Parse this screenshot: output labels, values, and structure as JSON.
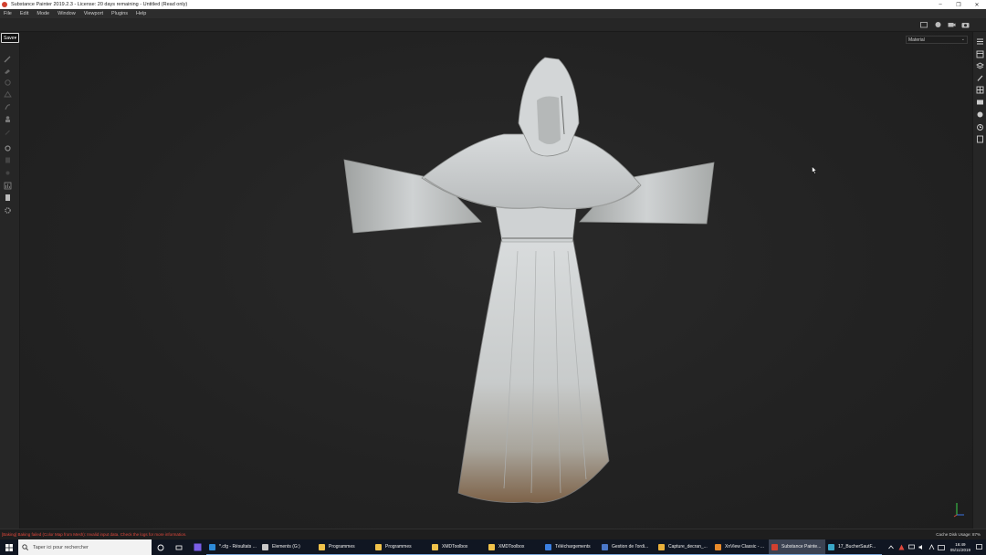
{
  "window": {
    "title": "Substance Painter 2019.2.3 - License: 20 days remaining - Untitled (Read only)",
    "controls": [
      "–",
      "❐",
      "✕"
    ]
  },
  "menu": [
    "File",
    "Edit",
    "Mode",
    "Window",
    "Viewport",
    "Plugins",
    "Help"
  ],
  "left_toolbar": {
    "save_label": "Save",
    "tools": [
      "paint-brush-icon",
      "eraser-icon",
      "projection-icon",
      "polygon-fill-icon",
      "smudge-icon",
      "clone-icon",
      "color-picker-icon",
      "settings-icon",
      "layers-stack-icon",
      "bake-icon",
      "histogram-icon",
      "document-icon",
      "gear-icon"
    ]
  },
  "viewport": {
    "material_mode": "Material",
    "top_right_tools": [
      "screenshot-folder-icon",
      "render-mode-icon",
      "camera-icon",
      "snapshot-icon"
    ],
    "model": "hooded-robe-3d-model"
  },
  "right_dock": [
    "texture-set-list-icon",
    "texture-set-settings-icon",
    "layers-icon",
    "properties-icon",
    "display-settings-icon",
    "shader-settings-icon",
    "viewer-settings-icon",
    "history-icon",
    "log-icon"
  ],
  "status": {
    "error": "[Baking] Baking failed (Color Map from Mesh): Invalid input data. Check the logs for more information.",
    "cache": "Cache Disk Usage:   87%",
    "error_color": "#e0483c"
  },
  "taskbar": {
    "search_placeholder": "Taper ici pour rechercher",
    "items": [
      {
        "label": "*.cfg - Résultats ...",
        "color": "#2d8ad8",
        "active": false
      },
      {
        "label": "Elements (G:)",
        "color": "#c8c8c8",
        "active": false
      },
      {
        "label": "Programmes",
        "color": "#f0c24a",
        "active": false
      },
      {
        "label": "Programmes",
        "color": "#f0c24a",
        "active": false
      },
      {
        "label": "XMDToolbox",
        "color": "#f0c24a",
        "active": false
      },
      {
        "label": "XMDToolbox",
        "color": "#f0c24a",
        "active": false
      },
      {
        "label": "Téléchargements",
        "color": "#3b7fe0",
        "active": false
      },
      {
        "label": "Gestion de l'ordi...",
        "color": "#4a77c8",
        "active": false
      },
      {
        "label": "Capture_decran_...",
        "color": "#e9b03a",
        "active": false
      },
      {
        "label": "XnView Classic - ...",
        "color": "#e88a2a",
        "active": false
      },
      {
        "label": "Substance Painte...",
        "color": "#d2402f",
        "active": true
      },
      {
        "label": "17_BucherSautF...",
        "color": "#3aa7c8",
        "active": false
      }
    ],
    "time": "16:49",
    "date": "05/11/2019"
  }
}
